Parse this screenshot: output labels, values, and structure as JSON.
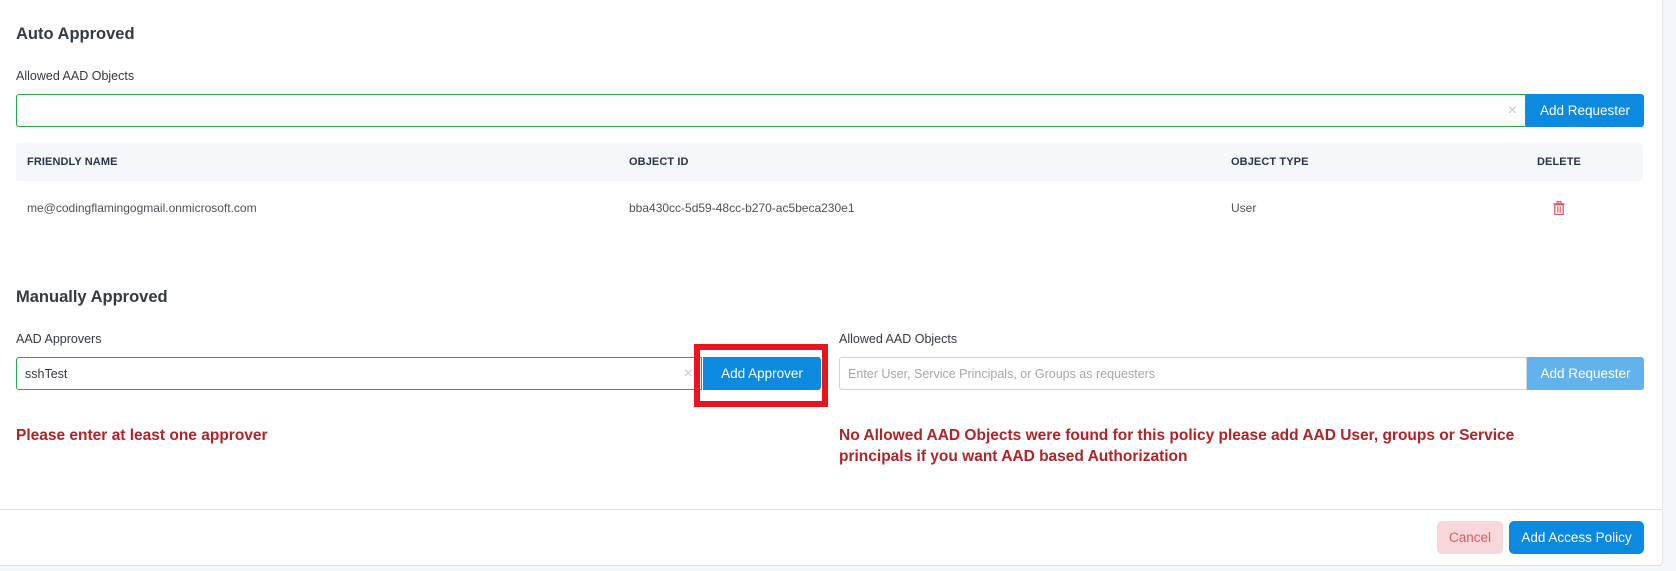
{
  "auto_approved": {
    "title": "Auto Approved",
    "allowed_label": "Allowed AAD Objects",
    "input_value": "",
    "clear_icon": "×",
    "add_button": "Add Requester",
    "table": {
      "columns": [
        "FRIENDLY NAME",
        "OBJECT ID",
        "OBJECT TYPE",
        "DELETE"
      ],
      "rows": [
        {
          "friendly_name": "me@codingflamingogmail.onmicrosoft.com",
          "object_id": "bba430cc-5d59-48cc-b270-ac5beca230e1",
          "object_type": "User",
          "delete_icon": "trash-icon"
        }
      ]
    }
  },
  "manually_approved": {
    "title": "Manually Approved",
    "approvers_label": "AAD Approvers",
    "approvers_value": "sshTest",
    "clear_icon": "×",
    "add_approver_button": "Add Approver",
    "allowed_label": "Allowed AAD Objects",
    "allowed_placeholder": "Enter User, Service Principals, or Groups as requesters",
    "allowed_value": "",
    "add_requester_button": "Add Requester",
    "approver_error": "Please enter at least one approver",
    "allowed_error": "No Allowed AAD Objects were found for this policy please add AAD User, groups or Service principals if you want AAD based Authorization"
  },
  "footer": {
    "cancel": "Cancel",
    "submit": "Add Access Policy"
  },
  "colors": {
    "primary": "#0b8ae0",
    "primary_disabled": "#62b3ec",
    "valid_border": "#28a745",
    "error_text": "#b02427",
    "cancel_bg": "#f8d7da",
    "cancel_text": "#e05a63",
    "highlight": "#e8141f"
  }
}
